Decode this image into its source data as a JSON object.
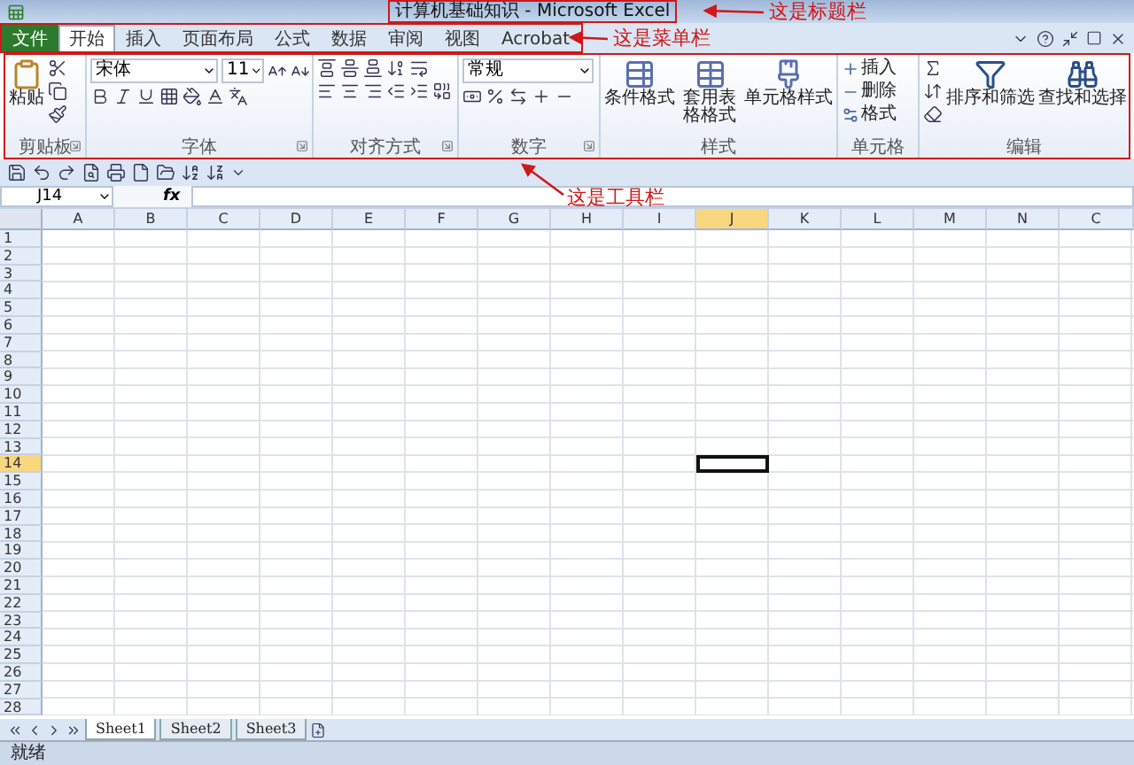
{
  "title_bar": {
    "title": "计算机基础知识 - Microsoft Excel"
  },
  "tabs": [
    {
      "label": "文件",
      "kind": "file",
      "selected": false
    },
    {
      "label": "开始",
      "kind": "tab",
      "selected": true
    },
    {
      "label": "插入",
      "kind": "tab",
      "selected": false
    },
    {
      "label": "页面布局",
      "kind": "tab",
      "selected": false
    },
    {
      "label": "公式",
      "kind": "tab",
      "selected": false
    },
    {
      "label": "数据",
      "kind": "tab",
      "selected": false
    },
    {
      "label": "审阅",
      "kind": "tab",
      "selected": false
    },
    {
      "label": "视图",
      "kind": "tab",
      "selected": false
    },
    {
      "label": "Acrobat",
      "kind": "tab",
      "selected": false
    }
  ],
  "ribbon": {
    "groups": [
      {
        "kind": "clipboard",
        "label": "剪贴板",
        "paste": "粘贴"
      },
      {
        "kind": "font",
        "label": "字体",
        "font_name": "宋体",
        "font_size": "11"
      },
      {
        "kind": "alignment",
        "label": "对齐方式"
      },
      {
        "kind": "number",
        "label": "数字",
        "format": "常规"
      },
      {
        "kind": "styles",
        "label": "样式",
        "buttons": [
          "条件格式",
          "套用表格格式",
          "单元格样式"
        ]
      },
      {
        "kind": "cells",
        "label": "单元格",
        "buttons": [
          "插入",
          "删除",
          "格式"
        ]
      },
      {
        "kind": "editing",
        "label": "编辑",
        "buttons": [
          "排序和筛选",
          "查找和选择"
        ]
      }
    ]
  },
  "formula_bar": {
    "name_box": "J14",
    "fx": "fx"
  },
  "columns": [
    {
      "label": "A",
      "selected": false
    },
    {
      "label": "B",
      "selected": false
    },
    {
      "label": "C",
      "selected": false
    },
    {
      "label": "D",
      "selected": false
    },
    {
      "label": "E",
      "selected": false
    },
    {
      "label": "F",
      "selected": false
    },
    {
      "label": "G",
      "selected": false
    },
    {
      "label": "H",
      "selected": false
    },
    {
      "label": "I",
      "selected": false
    },
    {
      "label": "J",
      "selected": true
    },
    {
      "label": "K",
      "selected": false
    },
    {
      "label": "L",
      "selected": false
    },
    {
      "label": "M",
      "selected": false
    },
    {
      "label": "N",
      "selected": false
    },
    {
      "label": "C",
      "selected": false
    }
  ],
  "rows": [
    {
      "label": "1",
      "selected": false
    },
    {
      "label": "2",
      "selected": false
    },
    {
      "label": "3",
      "selected": false
    },
    {
      "label": "4",
      "selected": false
    },
    {
      "label": "5",
      "selected": false
    },
    {
      "label": "6",
      "selected": false
    },
    {
      "label": "7",
      "selected": false
    },
    {
      "label": "8",
      "selected": false
    },
    {
      "label": "9",
      "selected": false
    },
    {
      "label": "10",
      "selected": false
    },
    {
      "label": "11",
      "selected": false
    },
    {
      "label": "12",
      "selected": false
    },
    {
      "label": "13",
      "selected": false
    },
    {
      "label": "14",
      "selected": true
    },
    {
      "label": "15",
      "selected": false
    },
    {
      "label": "16",
      "selected": false
    },
    {
      "label": "17",
      "selected": false
    },
    {
      "label": "18",
      "selected": false
    },
    {
      "label": "19",
      "selected": false
    },
    {
      "label": "20",
      "selected": false
    },
    {
      "label": "21",
      "selected": false
    },
    {
      "label": "22",
      "selected": false
    },
    {
      "label": "23",
      "selected": false
    },
    {
      "label": "24",
      "selected": false
    },
    {
      "label": "25",
      "selected": false
    },
    {
      "label": "26",
      "selected": false
    },
    {
      "label": "27",
      "selected": false
    },
    {
      "label": "28",
      "selected": false
    }
  ],
  "sheets": [
    {
      "label": "Sheet1",
      "selected": true
    },
    {
      "label": "Sheet2",
      "selected": false
    },
    {
      "label": "Sheet3",
      "selected": false
    }
  ],
  "status_bar": {
    "text": "就绪"
  },
  "annotations": [
    {
      "kind": "title",
      "text": "这是标题栏"
    },
    {
      "kind": "menu",
      "text": "这是菜单栏"
    },
    {
      "kind": "toolbar",
      "text": "这是工具栏"
    }
  ]
}
